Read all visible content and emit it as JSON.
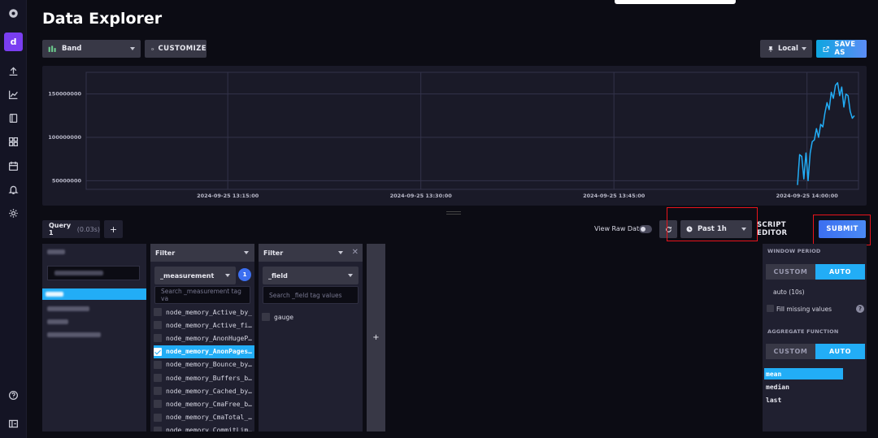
{
  "app": {
    "title": "Data Explorer",
    "org_initial": "d"
  },
  "toolbar": {
    "bucket_label": "Band",
    "customize_label": "CUSTOMIZE",
    "timezone_label": "Local",
    "save_as_label": "SAVE AS"
  },
  "chart_data": {
    "type": "line",
    "x_ticks": [
      "2024-09-25 13:15:00",
      "2024-09-25 13:30:00",
      "2024-09-25 13:45:00",
      "2024-09-25 14:00:00"
    ],
    "y_ticks": [
      "150000000",
      "100000000",
      "50000000"
    ],
    "ylim": [
      40000000,
      175000000
    ],
    "xlim": [
      "2024-09-25 13:04:00",
      "2024-09-25 14:04:00"
    ],
    "grid": true,
    "series": [
      {
        "color": "#22adf6",
        "x": [
          "14:00:00",
          "14:00:20",
          "14:00:40",
          "14:01:00",
          "14:01:20",
          "14:01:40",
          "14:02:00",
          "14:02:20",
          "14:02:40",
          "14:03:00",
          "14:03:20",
          "14:03:40",
          "14:04:00",
          "14:04:20",
          "14:04:40",
          "14:05:00",
          "14:05:20",
          "14:05:40",
          "14:06:00",
          "14:06:20",
          "14:06:40",
          "14:07:00",
          "14:07:20",
          "14:07:40",
          "14:08:00",
          "14:08:20",
          "14:08:40",
          "14:09:00"
        ],
        "values": [
          45000000,
          80000000,
          78000000,
          52000000,
          82000000,
          50000000,
          82000000,
          95000000,
          97000000,
          110000000,
          100000000,
          115000000,
          112000000,
          128000000,
          140000000,
          132000000,
          152000000,
          145000000,
          160000000,
          163000000,
          148000000,
          158000000,
          135000000,
          150000000,
          148000000,
          130000000,
          122000000,
          125000000
        ]
      }
    ]
  },
  "query": {
    "tab_label": "Query 1",
    "tab_timing": "(0.03s)",
    "add_label": "+",
    "view_raw_label": "View Raw Data",
    "time_range_label": "Past 1h",
    "script_editor_label": "SCRIPT EDITOR",
    "submit_label": "SUBMIT"
  },
  "filters": [
    {
      "header": "Filter",
      "key": "_measurement",
      "count": "1",
      "search_placeholder": "Search _measurement tag va",
      "items": [
        {
          "label": "node_memory_Active_by_",
          "selected": false
        },
        {
          "label": "node_memory_Active_fi…",
          "selected": false
        },
        {
          "label": "node_memory_AnonHugeP…",
          "selected": false
        },
        {
          "label": "node_memory_AnonPages…",
          "selected": true
        },
        {
          "label": "node_memory_Bounce_by…",
          "selected": false
        },
        {
          "label": "node_memory_Buffers_b…",
          "selected": false
        },
        {
          "label": "node_memory_Cached_by…",
          "selected": false
        },
        {
          "label": "node_memory_CmaFree_b…",
          "selected": false
        },
        {
          "label": "node_memory_CmaTotal_…",
          "selected": false
        },
        {
          "label": "node_memory_CommitLim…",
          "selected": false
        }
      ]
    },
    {
      "header": "Filter",
      "key": "_field",
      "search_placeholder": "Search _field tag values",
      "items": [
        {
          "label": "gauge",
          "selected": false
        }
      ]
    }
  ],
  "add_filter_label": "+",
  "aggregate": {
    "window_period_label": "WINDOW PERIOD",
    "custom_label": "CUSTOM",
    "auto_label": "AUTO",
    "auto_value": "auto (10s)",
    "fill_missing_label": "Fill missing values",
    "help_label": "?",
    "aggregate_function_label": "AGGREGATE FUNCTION",
    "functions": [
      {
        "label": "mean",
        "selected": true
      },
      {
        "label": "median",
        "selected": false
      },
      {
        "label": "last",
        "selected": false
      }
    ]
  },
  "colors": {
    "accent": "#22adf6",
    "highlight": "#e8141b",
    "background": "#0c0c14"
  }
}
